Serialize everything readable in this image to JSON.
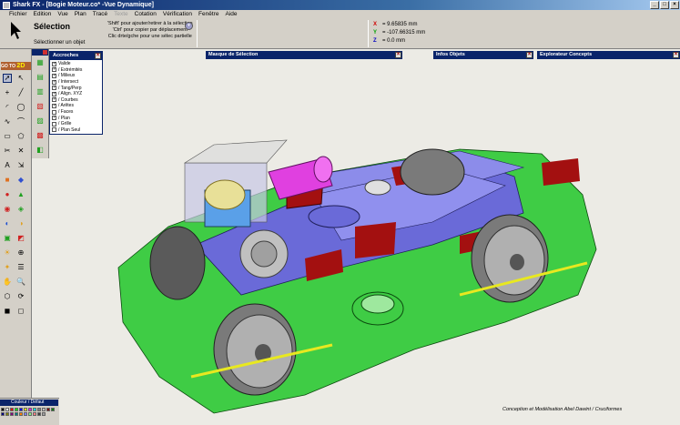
{
  "window": {
    "title": "Shark FX - [Bogie Moteur.co* -Vue Dynamique]",
    "controls": [
      "_",
      "□",
      "×"
    ]
  },
  "menu": [
    "Fichier",
    "Edition",
    "Vue",
    "Plan",
    "Tracé",
    "Texte",
    "Cotation",
    "Vérification",
    "Fenêtre",
    "Aide"
  ],
  "info": {
    "title": "Sélection",
    "subtitle": "Sélectionner un objet",
    "hint1": "'Shift' pour ajouter/retirer à la sélection",
    "hint2": "'Ctrl' pour copier par déplacement",
    "hint3": "Clic drte/gche pour une sélec partielle",
    "hint_button": "▾"
  },
  "coords": {
    "x_label": "X",
    "x": "= 9.65835 mm",
    "y_label": "Y",
    "y": "= -107.66315 mm",
    "z_label": "Z",
    "z": "= 0.0 mm"
  },
  "panels": {
    "selection_mask": "Masque de Sélection",
    "object_info": "Infos Objets",
    "concepts": "Explorateur Concepts",
    "close": "×"
  },
  "toolbar": {
    "header": "",
    "badge_go": "GO TO",
    "badge_2d": "2D"
  },
  "accroches": {
    "title": "Accroches",
    "items": [
      {
        "label": "Valide",
        "checked": true
      },
      {
        "label": "/ Extrémités",
        "checked": true
      },
      {
        "label": "/ Milieux",
        "checked": true
      },
      {
        "label": "/ Intersect",
        "checked": true
      },
      {
        "label": "/ Tang/Perp",
        "checked": true
      },
      {
        "label": "/ Align. XYZ",
        "checked": true
      },
      {
        "label": "/ Courbes",
        "checked": true
      },
      {
        "label": "/ Arêtes",
        "checked": true
      },
      {
        "label": "/ Faces",
        "checked": false
      },
      {
        "label": "/ Plan",
        "checked": true
      },
      {
        "label": "/ Grille",
        "checked": false
      },
      {
        "label": "/ Plan Seul",
        "checked": false
      }
    ]
  },
  "palette": {
    "title": "Couleur / Défaut",
    "colors": [
      "#000000",
      "#ffffff",
      "#ff0000",
      "#00ff00",
      "#0000ff",
      "#ffff00",
      "#ff00ff",
      "#00ffff",
      "#808080",
      "#c0c0c0",
      "#800000",
      "#008000",
      "#000080",
      "#808000",
      "#800080",
      "#008080",
      "#ff8000",
      "#8080ff",
      "#80ff80",
      "#ff8080",
      "#404040",
      "#a0a0a0"
    ]
  },
  "credit": "Conception et Modélisation Abel Dawint / Cruciformes",
  "colors": {
    "frame": "#3fcc45",
    "body": "#6a6ad8",
    "motor": "#e040e0",
    "accent": "#a31010",
    "wheel": "#9a9a9a"
  }
}
